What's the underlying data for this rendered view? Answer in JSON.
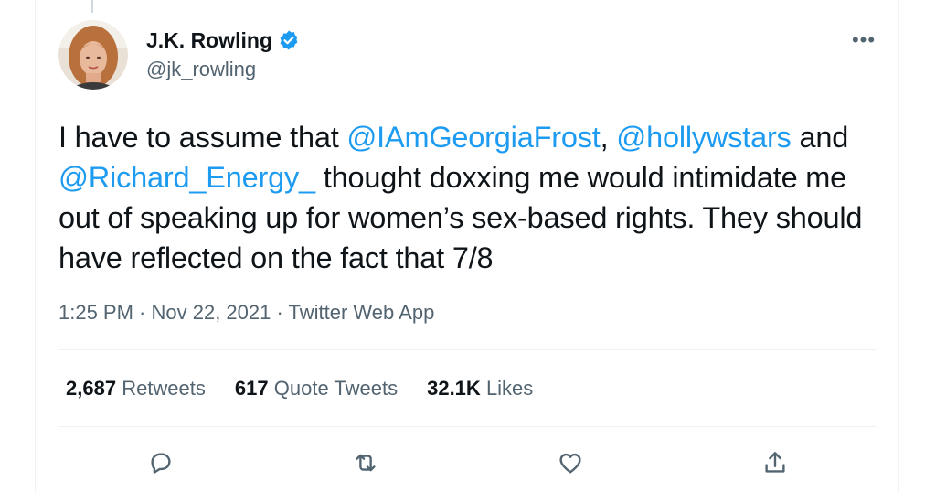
{
  "author": {
    "name": "J.K. Rowling",
    "handle": "@jk_rowling",
    "verified": true,
    "avatar_icon": "profile-photo"
  },
  "menu": {
    "more_label": "•••"
  },
  "tweet": {
    "segments": [
      {
        "text": "I have to assume that ",
        "mention": false
      },
      {
        "text": "@IAmGeorgiaFrost",
        "mention": true
      },
      {
        "text": ", ",
        "mention": false
      },
      {
        "text": "@hollywstars",
        "mention": true
      },
      {
        "text": " and ",
        "mention": false
      },
      {
        "text": "@Richard_Energy_",
        "mention": true
      },
      {
        "text": " thought doxxing me would intimidate me out of speaking up for women’s sex-based rights. They should have reflected on the fact that 7/8",
        "mention": false
      }
    ]
  },
  "meta": {
    "time": "1:25 PM",
    "separator": " · ",
    "date": "Nov 22, 2021",
    "source": "Twitter Web App"
  },
  "stats": {
    "retweets_count": "2,687",
    "retweets_label": "Retweets",
    "quotes_count": "617",
    "quotes_label": "Quote Tweets",
    "likes_count": "32.1K",
    "likes_label": "Likes"
  },
  "actions": {
    "reply_icon": "reply-icon",
    "retweet_icon": "retweet-icon",
    "like_icon": "like-icon",
    "share_icon": "share-icon"
  },
  "colors": {
    "accent": "#1d9bf0",
    "text": "#0f1419",
    "secondary": "#536471",
    "divider": "#eff3f4"
  }
}
